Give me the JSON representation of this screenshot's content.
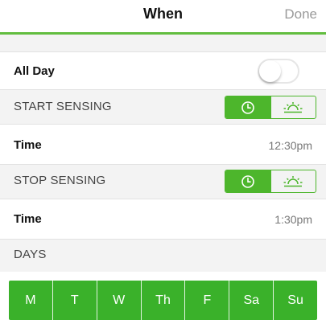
{
  "header": {
    "title": "When",
    "done_label": "Done"
  },
  "all_day": {
    "label": "All Day",
    "enabled": false
  },
  "start": {
    "section_label": "START SENSING",
    "mode_options": [
      "clock-icon",
      "sunrise-icon"
    ],
    "selected_mode": "clock-icon",
    "time_label": "Time",
    "time_value": "12:30pm"
  },
  "stop": {
    "section_label": "STOP SENSING",
    "mode_options": [
      "clock-icon",
      "sunrise-icon"
    ],
    "selected_mode": "clock-icon",
    "time_label": "Time",
    "time_value": "1:30pm"
  },
  "days": {
    "section_label": "DAYS",
    "items": [
      "M",
      "T",
      "W",
      "Th",
      "F",
      "Sa",
      "Su"
    ]
  },
  "colors": {
    "accent": "#4db62c",
    "days_background": "#3ab12a",
    "section_background": "#f3f3f3"
  }
}
